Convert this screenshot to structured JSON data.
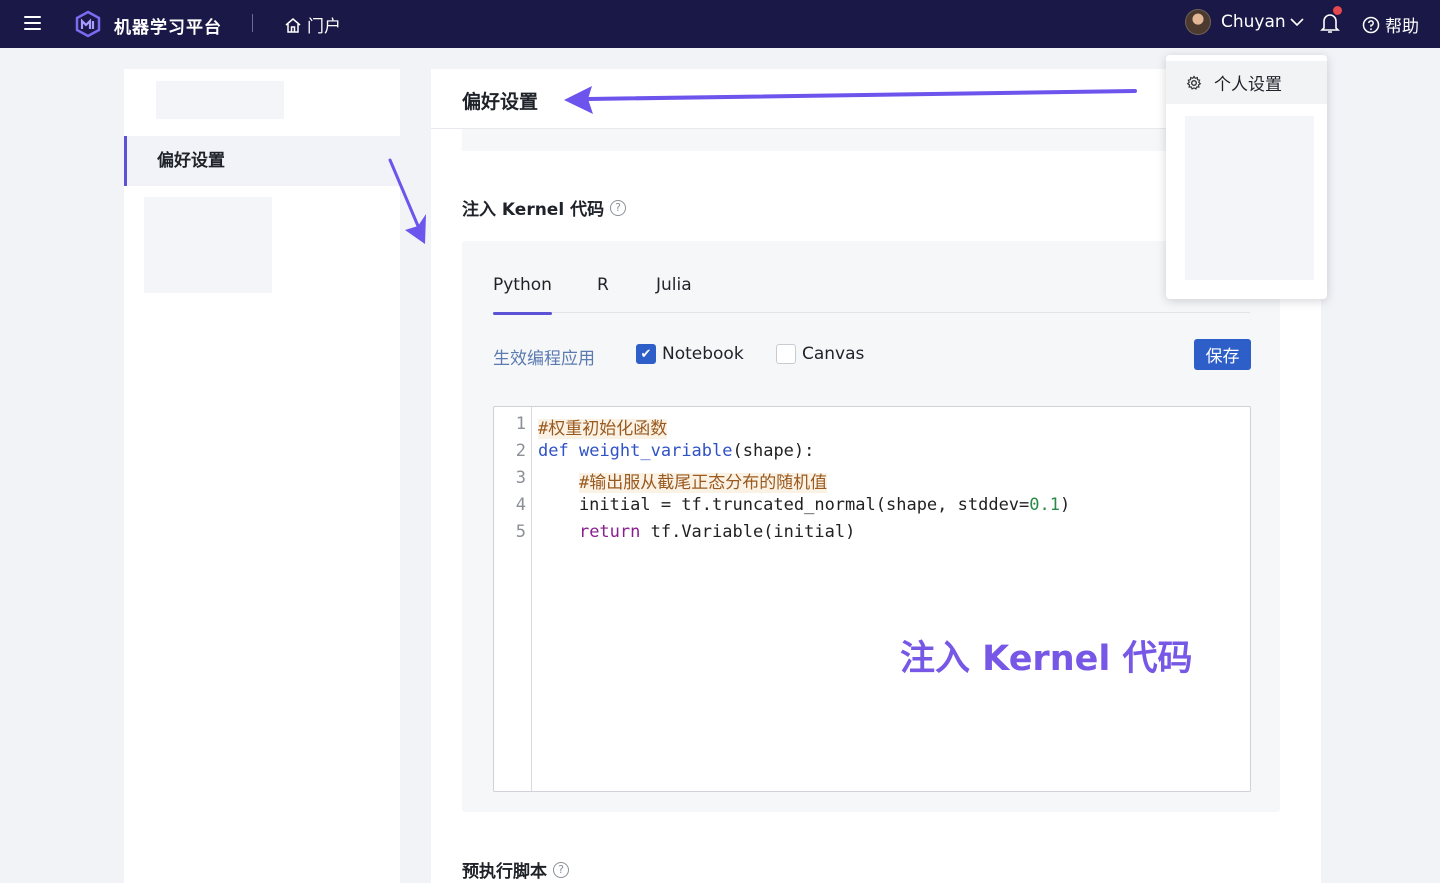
{
  "header": {
    "brand": "机器学习平台",
    "portal_label": "门户",
    "username": "Chuyan",
    "help_label": "帮助",
    "has_notification": true
  },
  "user_menu": {
    "items": [
      {
        "label": "个人设置",
        "icon": "gear-icon"
      }
    ]
  },
  "sidebar": {
    "items": [
      {
        "label": "偏好设置",
        "active": true
      }
    ]
  },
  "main": {
    "page_title": "偏好设置",
    "kernel_section_title": "注入 Kernel 代码",
    "tabs": [
      {
        "label": "Python",
        "active": true
      },
      {
        "label": "R",
        "active": false
      },
      {
        "label": "Julia",
        "active": false
      }
    ],
    "apply_label": "生效编程应用",
    "checkboxes": [
      {
        "label": "Notebook",
        "checked": true
      },
      {
        "label": "Canvas",
        "checked": false
      }
    ],
    "save_label": "保存",
    "code_lines": [
      "#权重初始化函数",
      "def weight_variable(shape):",
      "    #输出服从截尾正态分布的随机值",
      "    initial = tf.truncated_normal(shape, stddev=0.1)",
      "    return tf.Variable(initial)"
    ],
    "line_numbers": [
      "1",
      "2",
      "3",
      "4",
      "5"
    ],
    "overlay_annotation": "注入 Kernel 代码",
    "pre_exec_section_title": "预执行脚本"
  },
  "colors": {
    "topbar": "#1a1846",
    "accent": "#5b52d6",
    "primary_button": "#2e5fc9",
    "annotation": "#7657e6"
  }
}
